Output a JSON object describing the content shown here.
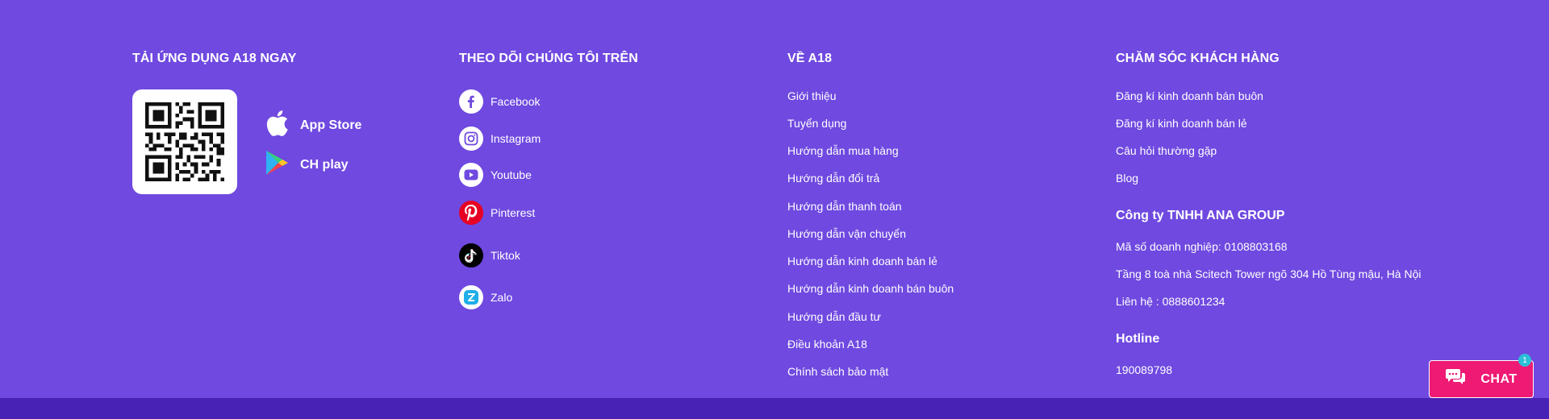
{
  "app": {
    "title": "TẢI ỨNG DỤNG A18 NGAY",
    "qr_icon": "qr-code",
    "stores": [
      {
        "label": "App Store",
        "icon": "apple-icon"
      },
      {
        "label": "CH play",
        "icon": "google-play-icon"
      }
    ]
  },
  "social": {
    "title": "THEO DÕI CHÚNG TÔI TRÊN",
    "items": [
      {
        "label": "Facebook",
        "icon": "facebook-icon"
      },
      {
        "label": "Instagram",
        "icon": "instagram-icon"
      },
      {
        "label": "Youtube",
        "icon": "youtube-icon"
      },
      {
        "label": "Pinterest",
        "icon": "pinterest-icon"
      },
      {
        "label": "Tiktok",
        "icon": "tiktok-icon"
      },
      {
        "label": "Zalo",
        "icon": "zalo-icon"
      }
    ]
  },
  "about": {
    "title": "VỀ A18",
    "links": [
      "Giới thiệu",
      "Tuyển dụng",
      "Hướng dẫn  mua hàng",
      "Hướng dẫn đổi trả",
      "Hướng dẫn thanh toán",
      "Hướng dẫn vận chuyển",
      "Hướng dẫn kinh doanh bán lẻ",
      "Hướng dẫn kinh doanh bán buôn",
      "Hướng dẫn đầu tư",
      "Điều khoản A18",
      "Chính sách bảo mật"
    ]
  },
  "care": {
    "title": "CHĂM SÓC KHÁCH HÀNG",
    "links": [
      "Đăng kí kinh doanh bán buôn",
      "Đăng kí kinh doanh bán lẻ",
      "Câu hỏi thường gặp",
      "Blog"
    ],
    "company_name": "Công ty TNHH ANA GROUP",
    "tax_id": "Mã  số doanh nghiệp: 0108803168",
    "address": "Tầng 8 toà nhà Scitech Tower ngõ 304 Hồ Tùng mậu, Hà Nội",
    "contact": "Liên hệ : 0888601234",
    "hotline_title": "Hotline",
    "hotline": "190089798"
  },
  "chat": {
    "label": "CHAT",
    "badge": "1",
    "icon": "chat-bubbles-icon"
  },
  "colors": {
    "background": "#6f49e0",
    "bottom_bar": "#4722b4",
    "chat": "#ee1a74",
    "badge": "#2bbfd8"
  }
}
